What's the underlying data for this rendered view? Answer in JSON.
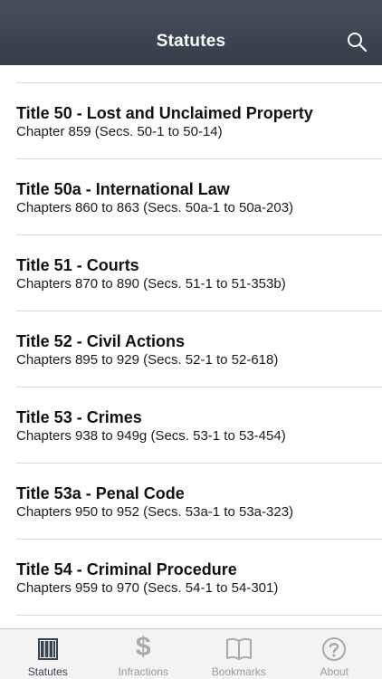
{
  "header": {
    "title": "Statutes"
  },
  "list": {
    "items": [
      {
        "title": "Title 50 - Lost and Unclaimed Property",
        "subtitle": "Chapter 859 (Secs. 50-1 to 50-14)"
      },
      {
        "title": "Title 50a - International Law",
        "subtitle": "Chapters 860 to 863 (Secs. 50a-1 to 50a-203)"
      },
      {
        "title": "Title 51 - Courts",
        "subtitle": "Chapters 870 to 890 (Secs. 51-1 to 51-353b)"
      },
      {
        "title": "Title 52 - Civil Actions",
        "subtitle": "Chapters 895 to 929 (Secs. 52-1 to 52-618)"
      },
      {
        "title": "Title 53 - Crimes",
        "subtitle": "Chapters 938 to 949g (Secs. 53-1 to 53-454)"
      },
      {
        "title": "Title 53a - Penal Code",
        "subtitle": "Chapters 950 to 952 (Secs. 53a-1 to 53a-323)"
      },
      {
        "title": "Title 54 - Criminal Procedure",
        "subtitle": "Chapters 959 to 970 (Secs. 54-1 to 54-301)"
      }
    ]
  },
  "tabbar": {
    "tabs": [
      {
        "label": "Statutes",
        "icon": "book-columns-icon",
        "active": true
      },
      {
        "label": "Infractions",
        "icon": "dollar-icon",
        "active": false
      },
      {
        "label": "Bookmarks",
        "icon": "open-book-icon",
        "active": false
      },
      {
        "label": "About",
        "icon": "question-icon",
        "active": false
      }
    ]
  },
  "colors": {
    "navbar": "#3d4652",
    "active_tab": "#3a4350",
    "inactive_tab": "#a9a9ae",
    "separator": "#d8d8db"
  }
}
